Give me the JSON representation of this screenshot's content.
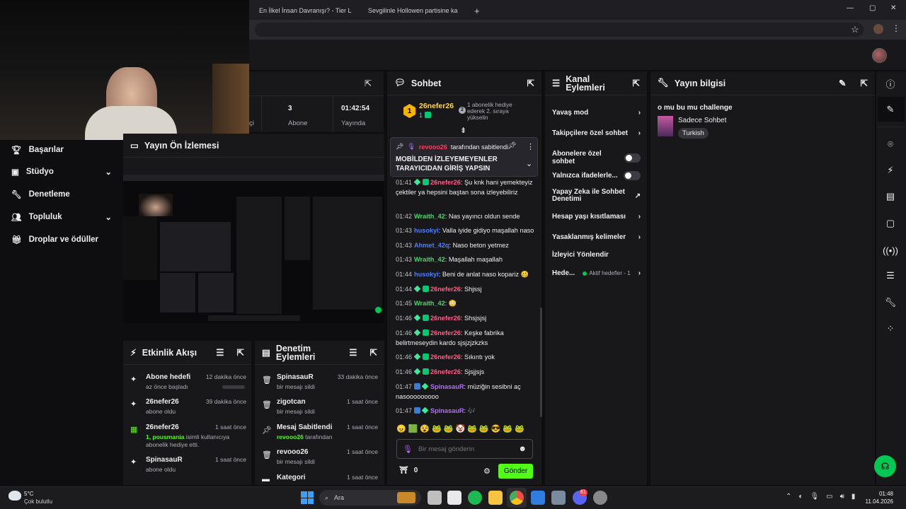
{
  "browser": {
    "tabs": [
      {
        "label": "En İlkel İnsan Davranışı? - Tier L"
      },
      {
        "label": "Sevgilinle Hollowen partisine ka"
      }
    ],
    "new_tab": "+",
    "window_controls": [
      "—",
      "▢",
      "✕"
    ]
  },
  "sidebar": {
    "items": [
      {
        "label": "Başarılar",
        "icon": "trophy-icon"
      },
      {
        "label": "Stüdyo",
        "icon": "studio-icon"
      },
      {
        "label": "Denetleme",
        "icon": "wrench-icon"
      },
      {
        "label": "Topluluk",
        "icon": "people-icon"
      },
      {
        "label": "Droplar ve ödüller",
        "icon": "gift-icon"
      }
    ]
  },
  "stats": {
    "partial_label": "çi",
    "subs_value": "3",
    "subs_label": "Abone",
    "time_value": "01:42:54",
    "time_label": "Yayında"
  },
  "preview": {
    "title": "Yayın Ön İzlemesi"
  },
  "activity": {
    "title": "Etkinlik Akışı",
    "items": [
      {
        "title": "Abone hedefi",
        "time": "12 dakika önce",
        "sub": "az önce başladı"
      },
      {
        "title": "26nefer26",
        "time": "39 dakika önce",
        "sub": "abone oldu"
      },
      {
        "title": "26nefer26",
        "time": "1 saat önce",
        "sub_highlight": "1, pousmania",
        "sub": "isimli kullanıcıya abonelik hediye etti."
      },
      {
        "title": "SpinasauR",
        "time": "1 saat önce",
        "sub": "abone oldu"
      }
    ]
  },
  "modlog": {
    "title_line1": "Denetim",
    "title_line2": "Eylemleri",
    "items": [
      {
        "title": "SpinasauR",
        "time": "33 dakika önce",
        "sub": "bir mesajı sildi"
      },
      {
        "title": "zigotcan",
        "time": "1 saat önce",
        "sub": "bir mesajı sildi"
      },
      {
        "title": "Mesaj Sabitlendi",
        "time": "1 saat önce",
        "sub_highlight": "revooo26",
        "sub": "tarafından"
      },
      {
        "title": "revooo26",
        "time": "1 saat önce",
        "sub": "bir mesajı sildi"
      },
      {
        "title": "Kategori",
        "time": "1 saat önce",
        "sub": ""
      }
    ]
  },
  "chat": {
    "title": "Sohbet",
    "gifter": {
      "rank": "1",
      "name": "26nefer26",
      "count": "1",
      "note": "1 abonelik hediye ederek 2. sıraya yükselin"
    },
    "pinned": {
      "by_user": "revooo26",
      "by_suffix": "tarafından sabitlendi",
      "message": "MOBİLDEN İZLEYEMEYENLER TARAYICIDAN GİRİŞ YAPSIN"
    },
    "messages": [
      {
        "time": "01:41",
        "user": "26nefer26",
        "color": "r",
        "badges": 2,
        "text": "Şu knk hani yemekteyiz çektiler ya hepsini baştan sona izleyebiliriz"
      },
      {
        "time": "01:42",
        "user": "Wraith_42",
        "color": "g",
        "badges": 0,
        "text": "Nas yayıncı oldun sende"
      },
      {
        "time": "01:43",
        "user": "husokyi",
        "color": "b",
        "badges": 0,
        "text": "Valla iyide gidiyo maşallah naso"
      },
      {
        "time": "01:43",
        "user": "Ahmet_42q",
        "color": "b",
        "badges": 0,
        "text": "Naso beton yetmez"
      },
      {
        "time": "01:43",
        "user": "Wraith_42",
        "color": "g",
        "badges": 0,
        "text": "Maşallah maşallah"
      },
      {
        "time": "01:44",
        "user": "husokyi",
        "color": "b",
        "badges": 0,
        "text": "Beni de anlat naso kopariz 🥴"
      },
      {
        "time": "01:44",
        "user": "26nefer26",
        "color": "r",
        "badges": 2,
        "text": "Shjssj"
      },
      {
        "time": "01:45",
        "user": "Wraith_42",
        "color": "g",
        "badges": 0,
        "text": "😳"
      },
      {
        "time": "01:46",
        "user": "26nefer26",
        "color": "r",
        "badges": 2,
        "text": "Shsjsjsj"
      },
      {
        "time": "01:46",
        "user": "26nefer26",
        "color": "r",
        "badges": 2,
        "text": "Keşke fabrika belirtmeseydin kardo sjsjzjzkzks"
      },
      {
        "time": "01:46",
        "user": "26nefer26",
        "color": "r",
        "badges": 2,
        "text": "Sıkıntı yok"
      },
      {
        "time": "01:46",
        "user": "26nefer26",
        "color": "r",
        "badges": 2,
        "text": "Sjsjjsjs"
      },
      {
        "time": "01:47",
        "user": "SpinasauR",
        "color": "p",
        "badges": 2,
        "text": "müziğin sesibni aç nasooooooooo"
      },
      {
        "time": "01:47",
        "user": "SpinasauR",
        "color": "p",
        "badges": 2,
        "text": "🎶"
      }
    ],
    "emotes": [
      "😠",
      "🟩",
      "😵",
      "🐸",
      "🐸",
      "🤡",
      "🐸",
      "🐸",
      "😎",
      "🐸",
      "🐸"
    ],
    "input_placeholder": "Bir mesaj gönderin",
    "points": "0",
    "send_label": "Gönder"
  },
  "channel_actions": {
    "title_line1": "Kanal",
    "title_line2": "Eylemleri",
    "items": [
      {
        "label": "Yavaş mod",
        "control": "chevron"
      },
      {
        "label": "Takipçilere özel sohbet",
        "control": "chevron"
      },
      {
        "label": "Abonelere özel sohbet",
        "control": "toggle"
      },
      {
        "label": "Yalnızca ifadelerle...",
        "control": "toggle"
      },
      {
        "label": "Yapay Zeka ile Sohbet Denetimi",
        "control": "external"
      },
      {
        "label": "Hesap yaşı kısıtlaması",
        "control": "chevron"
      },
      {
        "label": "Yasaklanmış kelimeler",
        "control": "chevron"
      },
      {
        "label": "İzleyici Yönlendir",
        "control": "none"
      },
      {
        "label": "Hede...",
        "control": "chevron",
        "extra": "Aktif hedefler - 1"
      }
    ]
  },
  "stream_info": {
    "title": "Yayın bilgisi",
    "stream_title": "o mu bu mu challenge",
    "category": "Sadece Sohbet",
    "tag": "Turkish"
  },
  "taskbar": {
    "weather_temp": "5°C",
    "weather_desc": "Çok bulutlu",
    "search": "Ara",
    "clock_time": "01:48",
    "clock_date": "11.04.2026",
    "discord_badge": "61"
  },
  "colors": {
    "accent": "#53fc18",
    "panel": "#18181b",
    "bg": "#0e0e10"
  }
}
